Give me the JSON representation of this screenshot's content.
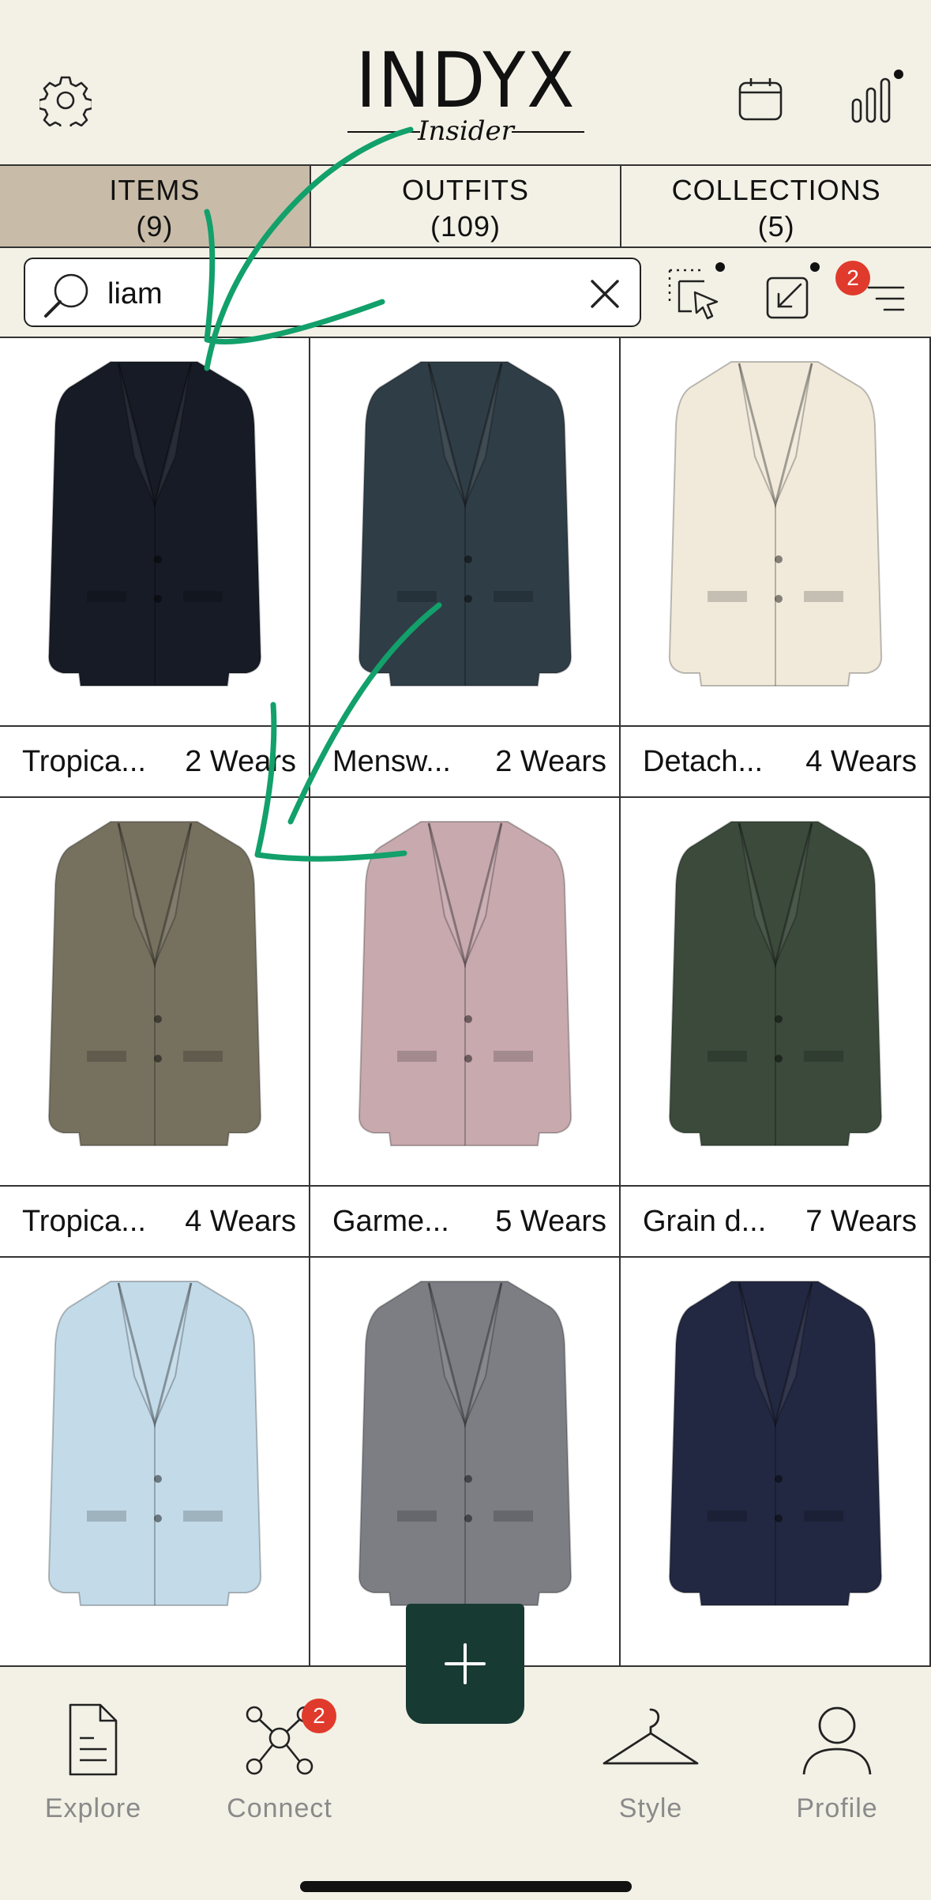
{
  "app": {
    "logo_text": "INDYX",
    "logo_subtitle": "Insider"
  },
  "header_icons": [
    "gear-icon",
    "calendar-icon",
    "bar-chart-icon"
  ],
  "tabs": [
    {
      "label": "ITEMS",
      "count": "(9)",
      "active": true
    },
    {
      "label": "OUTFITS",
      "count": "(109)",
      "active": false
    },
    {
      "label": "COLLECTIONS",
      "count": "(5)",
      "active": false
    }
  ],
  "search": {
    "value": "liam"
  },
  "toolbar": {
    "filter_badge": "2"
  },
  "items": [
    {
      "name": "Tropica...",
      "wears": "2 Wears",
      "color": "#161b26"
    },
    {
      "name": "Mensw...",
      "wears": "2 Wears",
      "color": "#2f3d46"
    },
    {
      "name": "Detach...",
      "wears": "4 Wears",
      "color": "#f1eadb"
    },
    {
      "name": "Tropica...",
      "wears": "4 Wears",
      "color": "#76705f"
    },
    {
      "name": "Garme...",
      "wears": "5 Wears",
      "color": "#c7a9ae"
    },
    {
      "name": "Grain d...",
      "wears": "7 Wears",
      "color": "#3b4a3b"
    },
    {
      "name": "",
      "wears": "",
      "color": "#c3dbe9"
    },
    {
      "name": "",
      "wears": "",
      "color": "#7d7e84"
    },
    {
      "name": "",
      "wears": "",
      "color": "#222842"
    }
  ],
  "nav": [
    {
      "label": "Explore",
      "icon": "document-icon"
    },
    {
      "label": "Connect",
      "icon": "network-icon",
      "badge": "2"
    },
    {
      "label": "Style",
      "icon": "hanger-icon"
    },
    {
      "label": "Profile",
      "icon": "person-icon"
    }
  ],
  "fab": {
    "icon": "plus-icon"
  },
  "annotation_color": "#12a06b"
}
